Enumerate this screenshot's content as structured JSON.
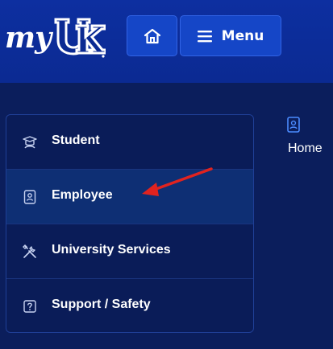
{
  "header": {
    "logo_text": "my",
    "logo_mark": "UK",
    "home_icon": "home-icon",
    "menu_icon": "hamburger-icon",
    "menu_label": "Menu"
  },
  "sidebar": {
    "items": [
      {
        "label": "Student",
        "icon": "graduation-cap-icon"
      },
      {
        "label": "Employee",
        "icon": "id-badge-icon"
      },
      {
        "label": "University Services",
        "icon": "tools-icon"
      },
      {
        "label": "Support / Safety",
        "icon": "question-icon"
      }
    ]
  },
  "content": {
    "icon": "id-badge-icon",
    "label": "Home"
  },
  "colors": {
    "background": "#0b1e5c",
    "header": "#0d2fa0",
    "button": "#1546c7",
    "accent_icon": "#4b8bff",
    "arrow": "#e0231f"
  }
}
